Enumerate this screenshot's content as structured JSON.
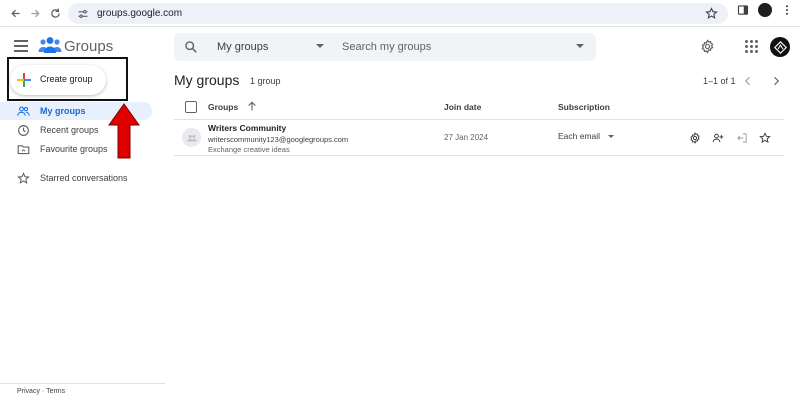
{
  "browser": {
    "url": "groups.google.com",
    "icons": [
      "back-arrow-icon",
      "forward-arrow-icon",
      "reload-icon",
      "site-settings-icon",
      "bookmark-star-icon",
      "side-panel-icon",
      "more-vert-icon"
    ]
  },
  "header": {
    "product_name": "Groups",
    "search": {
      "scope_label": "My groups",
      "placeholder": "Search my groups"
    }
  },
  "sidebar": {
    "create_button_label": "Create group",
    "items": [
      {
        "label": "My groups",
        "icon": "people-icon",
        "active": true
      },
      {
        "label": "Recent groups",
        "icon": "clock-icon",
        "active": false
      },
      {
        "label": "Favourite groups",
        "icon": "folder-icon",
        "active": false
      },
      {
        "label": "Starred conversations",
        "icon": "star-icon",
        "active": false
      }
    ],
    "footer": {
      "privacy": "Privacy",
      "separator": " · ",
      "terms": "Terms"
    }
  },
  "main": {
    "title": "My groups",
    "count": "1 group",
    "pagination": "1–1 of 1",
    "columns": {
      "groups": "Groups",
      "join_date": "Join date",
      "subscription": "Subscription"
    },
    "rows": [
      {
        "name": "Writers Community",
        "email": "writerscommunity123@googlegroups.com",
        "description": "Exchange creative ideas",
        "join_date": "27 Jan 2024",
        "subscription": "Each email"
      }
    ]
  },
  "colors": {
    "accent": "#1a73e8",
    "active_bg": "#e8f0fe",
    "annotation_red": "#e00000"
  }
}
